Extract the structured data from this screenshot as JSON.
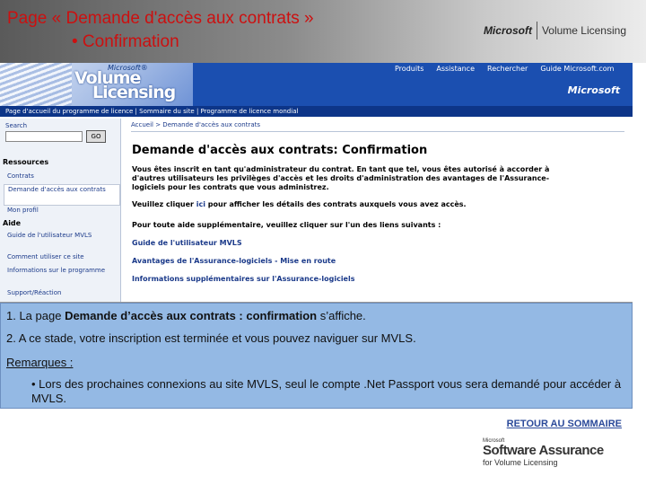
{
  "slide": {
    "title_line1": "Page « Demande d'accès aux contrats »",
    "title_line2": "• Confirmation",
    "logo_ms": "Microsoft",
    "logo_vl": "Volume Licensing",
    "title_color": "#cc1010"
  },
  "screenshot": {
    "banner": {
      "logo_ms_small": "Microsoft®",
      "logo_word1": "Volume",
      "logo_word2": "Licensing",
      "topnav": [
        "Produits",
        "Assistance",
        "Rechercher",
        "Guide Microsoft.com"
      ],
      "ms_logo": "Microsoft",
      "subnav": "Page d'accueil du programme de licence  |  Sommaire du site  |  Programme de licence mondial"
    },
    "sidebar": {
      "search_label": "Search",
      "go_label": "GO",
      "section_resources": "Ressources",
      "items_resources": [
        "Contrats",
        "Demande d'accès aux contrats",
        "Mon profil"
      ],
      "section_help": "Aide",
      "items_help": [
        "Guide de l'utilisateur MVLS",
        "Comment utiliser ce site",
        "Informations sur le programme",
        "Support/Réaction"
      ]
    },
    "main": {
      "breadcrumb": "Accueil  >  Demande d'accès aux contrats",
      "heading": "Demande d'accès aux contrats: Confirmation",
      "para1": "Vous êtes inscrit en tant qu'administrateur du contrat. En tant que tel, vous êtes autorisé à accorder à d'autres utilisateurs les privilèges d'accès et les droits d'administration des avantages de l'Assurance-logiciels pour les contrats que vous administrez.",
      "para2_prefix": "Veuillez cliquer ",
      "para2_link": "ici",
      "para2_suffix": " pour afficher les détails des contrats auxquels vous avez accès.",
      "para3": "Pour toute aide supplémentaire, veuillez cliquer sur l'un des liens suivants :",
      "links": [
        "Guide de l'utilisateur MVLS",
        "Avantages de l'Assurance-logiciels - Mise en route",
        "Informations supplémentaires sur l'Assurance-logiciels"
      ]
    }
  },
  "notes": {
    "line1_prefix": "1. La page ",
    "line1_bold": "Demande d’accès aux contrats : confirmation",
    "line1_suffix": " s’affiche.",
    "line2": "2. A ce stade, votre inscription est terminée et vous pouvez naviguer sur MVLS.",
    "remarks": "Remarques :",
    "bullet": "• Lors des prochaines connexions au site MVLS, seul le compte .Net Passport vous sera demandé pour accéder à MVLS."
  },
  "footer": {
    "retour": "RETOUR AU SOMMAIRE",
    "sa_ms": "Microsoft",
    "sa_title": "Software Assurance",
    "sa_sub": "for Volume Licensing"
  }
}
